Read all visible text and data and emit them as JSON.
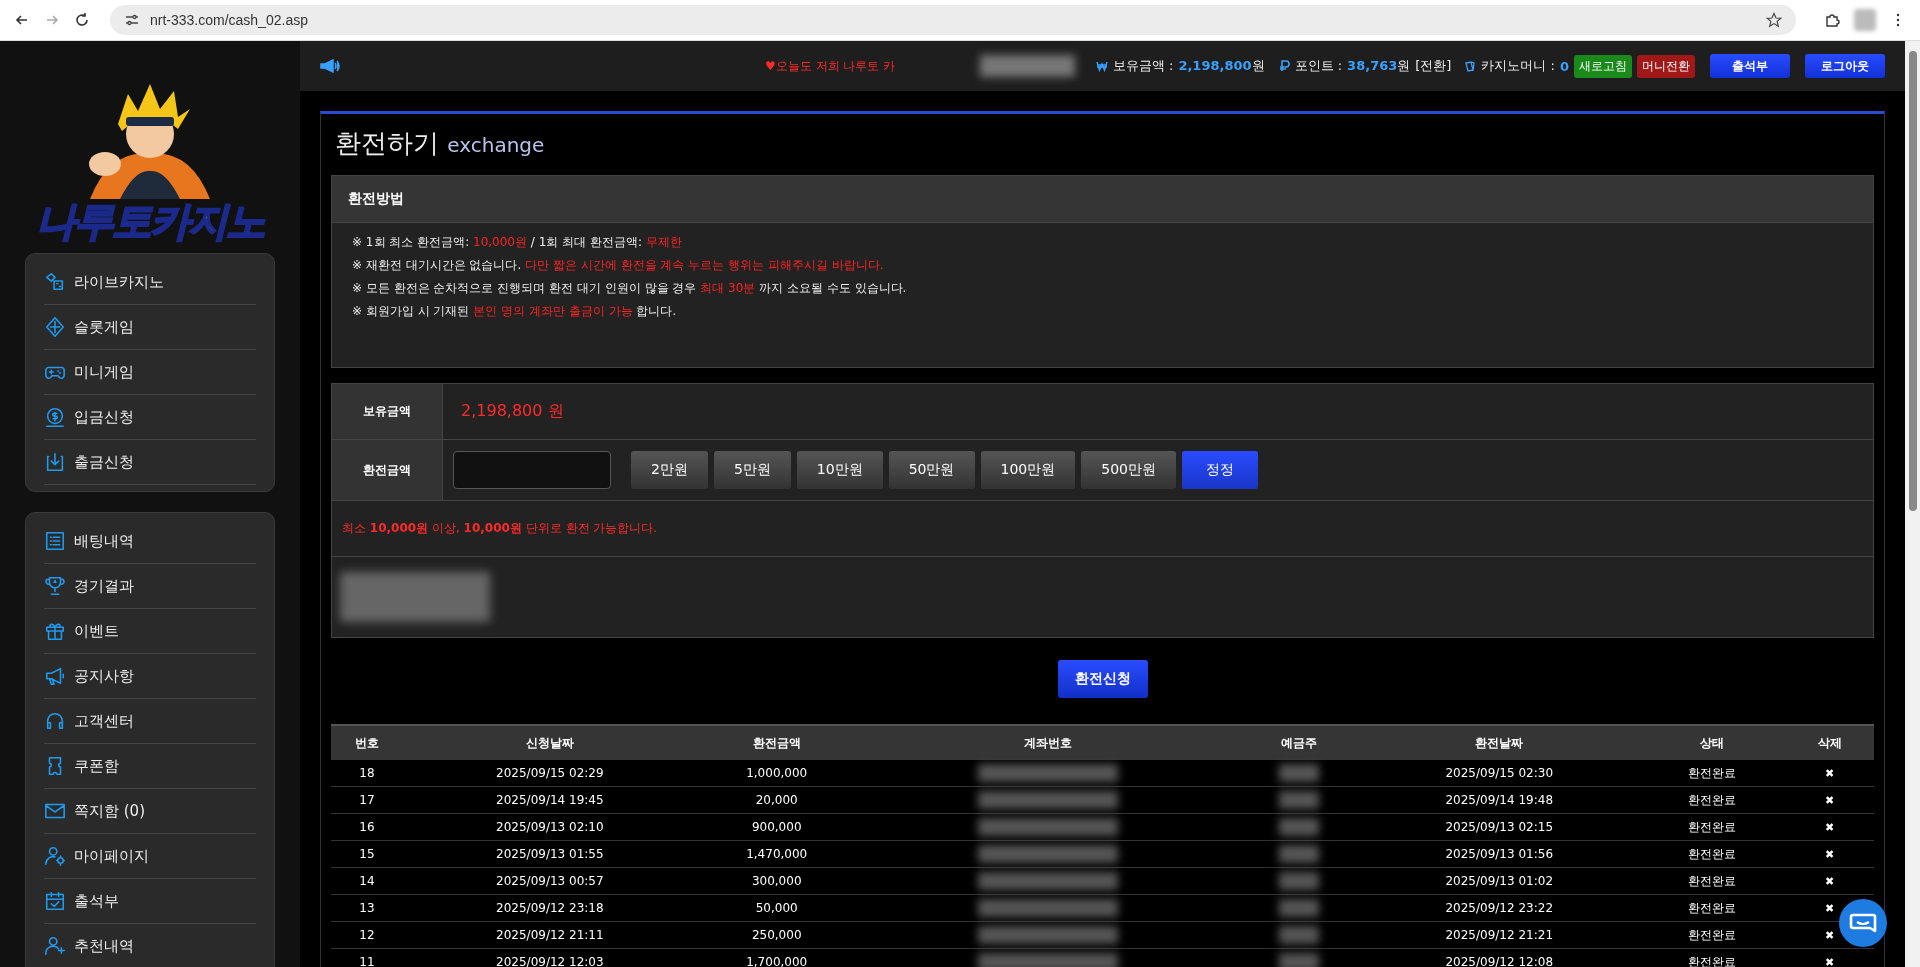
{
  "browser": {
    "url": "nrt-333.com/cash_02.asp"
  },
  "sidebar": {
    "logo_text": "나루토카지노",
    "groups": [
      {
        "items": [
          {
            "label": "라이브카지노"
          },
          {
            "label": "슬롯게임"
          },
          {
            "label": "미니게임"
          },
          {
            "label": "입금신청"
          },
          {
            "label": "출금신청"
          }
        ]
      },
      {
        "items": [
          {
            "label": "배팅내역"
          },
          {
            "label": "경기결과"
          },
          {
            "label": "이벤트"
          },
          {
            "label": "공지사항"
          },
          {
            "label": "고객센터"
          },
          {
            "label": "쿠폰함"
          },
          {
            "label": "쪽지함 (0)"
          },
          {
            "label": "마이페이지"
          },
          {
            "label": "출석부"
          },
          {
            "label": "추천내역"
          }
        ]
      }
    ]
  },
  "topbar": {
    "marquee": "♥오늘도 저희 나루토 카",
    "balance_label": "보유금액 :",
    "balance": "2,198,800",
    "balance_unit": "원",
    "points_label": "포인트 :",
    "points": "38,763",
    "points_unit": "원",
    "points_link": "[전환]",
    "casino_label": "카지노머니 :",
    "casino_value": "0",
    "badges": [
      {
        "label": "새로고침",
        "color": "#1a8a1a"
      },
      {
        "label": "머니전환",
        "color": "#a01818"
      }
    ],
    "buttons": [
      "출석부",
      "로그아웃"
    ]
  },
  "page": {
    "title": "환전하기",
    "subtitle": "exchange"
  },
  "notice": {
    "title": "환전방법",
    "lines": [
      [
        {
          "text": "※ 1회 최소 환전금액: ",
          "red": false
        },
        {
          "text": "10,000원",
          "red": true
        },
        {
          "text": " / 1회 최대 환전금액: ",
          "red": false
        },
        {
          "text": "무제한",
          "red": true
        }
      ],
      [
        {
          "text": "※ 재환전 대기시간은 없습니다. ",
          "red": false
        },
        {
          "text": "다만 짧은 시간에 환전을 계속 누르는 행위는 피해주시길 바랍니다.",
          "red": true
        }
      ],
      [
        {
          "text": "※ 모든 환전은 순차적으로 진행되며 환전 대기 인원이 많을 경우 ",
          "red": false
        },
        {
          "text": "최대 30분",
          "red": true
        },
        {
          "text": " 까지 소요될 수도 있습니다.",
          "red": false
        }
      ],
      [
        {
          "text": "※ 회원가입 시 기재된 ",
          "red": false
        },
        {
          "text": "본인 명의 계좌만 출금이 가능",
          "red": true
        },
        {
          "text": " 합니다.",
          "red": false
        }
      ]
    ]
  },
  "form": {
    "balance_label": "보유금액",
    "balance_value": "2,198,800 원",
    "amount_label": "환전금액",
    "quick_buttons": [
      {
        "label": "2만원",
        "kind": "amount"
      },
      {
        "label": "5만원",
        "kind": "amount"
      },
      {
        "label": "10만원",
        "kind": "amount"
      },
      {
        "label": "50만원",
        "kind": "amount"
      },
      {
        "label": "100만원",
        "kind": "amount"
      },
      {
        "label": "500만원",
        "kind": "amount"
      },
      {
        "label": "정정",
        "kind": "reset"
      }
    ],
    "info": "최소 **10,000원** 이상, **10,000원**  단위로 환전 가능합니다.",
    "submit": "환전신청"
  },
  "history": {
    "columns": [
      "번호",
      "신청날짜",
      "환전금액",
      "계좌번호",
      "예금주",
      "환전날짜",
      "상태",
      "삭제"
    ],
    "rows": [
      {
        "no": "18",
        "requested": "2025/09/15 02:29",
        "amount": "1,000,000",
        "completed": "2025/09/15 02:30",
        "status": "환전완료",
        "delete": "✖"
      },
      {
        "no": "17",
        "requested": "2025/09/14 19:45",
        "amount": "20,000",
        "completed": "2025/09/14 19:48",
        "status": "환전완료",
        "delete": "✖"
      },
      {
        "no": "16",
        "requested": "2025/09/13 02:10",
        "amount": "900,000",
        "completed": "2025/09/13 02:15",
        "status": "환전완료",
        "delete": "✖"
      },
      {
        "no": "15",
        "requested": "2025/09/13 01:55",
        "amount": "1,470,000",
        "completed": "2025/09/13 01:56",
        "status": "환전완료",
        "delete": "✖"
      },
      {
        "no": "14",
        "requested": "2025/09/13 00:57",
        "amount": "300,000",
        "completed": "2025/09/13 01:02",
        "status": "환전완료",
        "delete": "✖"
      },
      {
        "no": "13",
        "requested": "2025/09/12 23:18",
        "amount": "50,000",
        "completed": "2025/09/12 23:22",
        "status": "환전완료",
        "delete": "✖"
      },
      {
        "no": "12",
        "requested": "2025/09/12 21:11",
        "amount": "250,000",
        "completed": "2025/09/12 21:21",
        "status": "환전완료",
        "delete": "✖"
      },
      {
        "no": "11",
        "requested": "2025/09/12 12:03",
        "amount": "1,700,000",
        "completed": "2025/09/12 12:08",
        "status": "환전완료",
        "delete": "✖"
      }
    ]
  }
}
